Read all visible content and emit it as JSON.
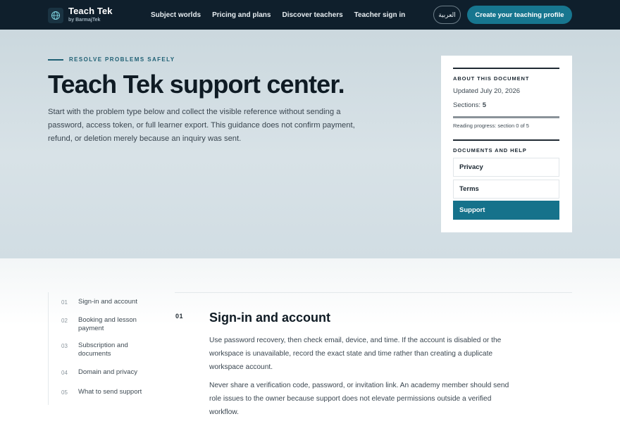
{
  "brand": {
    "name": "Teach Tek",
    "sub": "by BarmajTek"
  },
  "nav": [
    {
      "label": "Subject worlds"
    },
    {
      "label": "Pricing and plans"
    },
    {
      "label": "Discover teachers"
    },
    {
      "label": "Teacher sign in"
    }
  ],
  "lang_button": "العربية",
  "cta_button": "Create your teaching profile",
  "hero": {
    "eyebrow": "RESOLVE PROBLEMS SAFELY",
    "title": "Teach Tek support center.",
    "lead": "Start with the problem type below and collect the visible reference without sending a password, access token, or full learner export. This guidance does not confirm payment, refund, or deletion merely because an inquiry was sent."
  },
  "doc_card": {
    "about_heading": "ABOUT THIS DOCUMENT",
    "updated": "Updated July 20, 2026",
    "sections_label": "Sections:",
    "sections_count": "5",
    "progress_text": "Reading progress: section 0 of 5",
    "progress_fraction": 0,
    "docs_heading": "DOCUMENTS AND HELP",
    "links": [
      {
        "label": "Privacy",
        "active": false
      },
      {
        "label": "Terms",
        "active": false
      },
      {
        "label": "Support",
        "active": true
      }
    ]
  },
  "toc": [
    {
      "num": "01",
      "label": "Sign-in and account"
    },
    {
      "num": "02",
      "label": "Booking and lesson payment"
    },
    {
      "num": "03",
      "label": "Subscription and documents"
    },
    {
      "num": "04",
      "label": "Domain and privacy"
    },
    {
      "num": "05",
      "label": "What to send support"
    }
  ],
  "section": {
    "num": "01",
    "title": "Sign-in and account",
    "paragraphs": [
      "Use password recovery, then check email, device, and time. If the account is disabled or the workspace is unavailable, record the exact state and time rather than creating a duplicate workspace account.",
      "Never share a verification code, password, or invitation link. An academy member should send role issues to the owner because support does not elevate permissions outside a verified workflow."
    ]
  },
  "colors": {
    "topbar": "#0f1f2c",
    "accent": "#17768f",
    "active_link": "#16728b"
  }
}
